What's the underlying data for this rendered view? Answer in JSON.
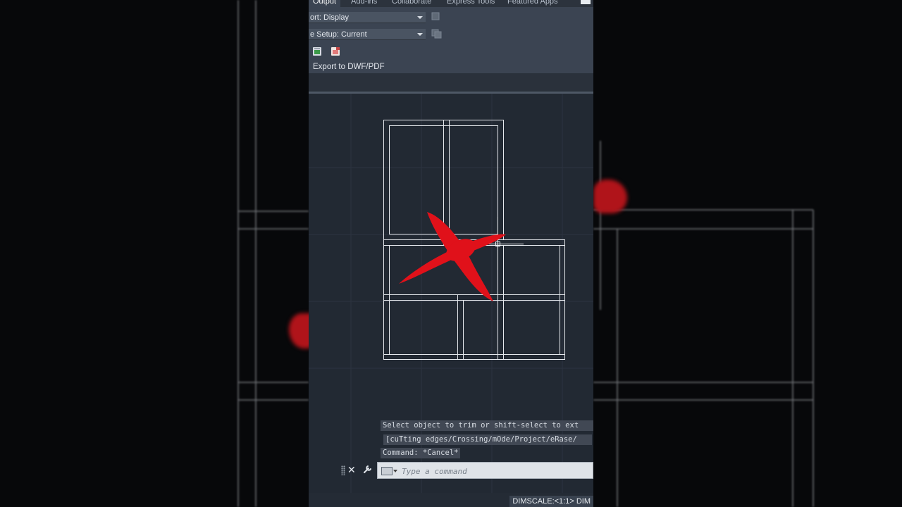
{
  "ribbon": {
    "tabs": [
      {
        "label": "Output",
        "active": true
      },
      {
        "label": "Add-ins",
        "active": false
      },
      {
        "label": "Collaborate",
        "active": false
      },
      {
        "label": "Express Tools",
        "active": false
      },
      {
        "label": "Featured Apps",
        "active": false
      }
    ],
    "export_combo": "ort: Display",
    "page_setup_combo": "e Setup: Current",
    "panel_label": "Export to DWF/PDF"
  },
  "console": {
    "line1": "Select object to trim or shift-select to ext",
    "line2": "[cuTting edges/Crossing/mOde/Project/eRase/",
    "line3": "Command: *Cancel*"
  },
  "command_line": {
    "placeholder": "Type a command"
  },
  "status": {
    "dimscale": "DIMSCALE:<1:1> DIM"
  },
  "icons": {
    "close": "close-icon",
    "wrench": "wrench-icon",
    "command_history": "command-history-icon"
  },
  "colors": {
    "annotation_red": "#e0111a",
    "canvas_bg": "#222933",
    "ribbon_bg": "#3b4452"
  }
}
